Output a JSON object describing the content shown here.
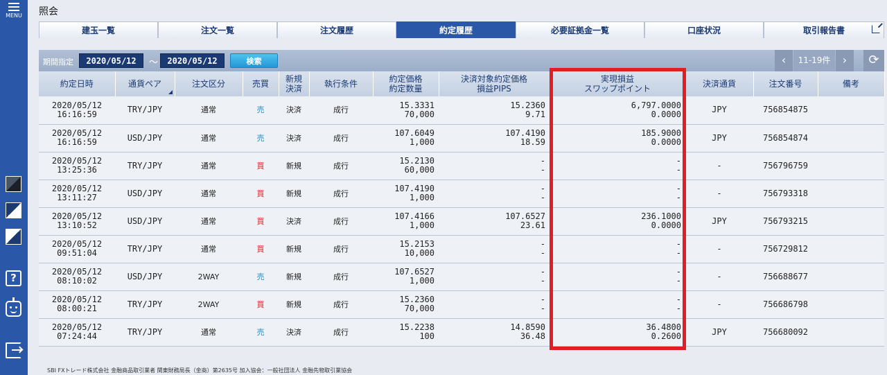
{
  "sidebar": {
    "menu_label": "MENU",
    "help_glyph": "?",
    "icons": [
      "theme-dark-icon",
      "theme-light-icon",
      "theme-blue-icon",
      "help-icon",
      "robot-icon",
      "logout-icon"
    ]
  },
  "page": {
    "title": "照会"
  },
  "tabs": [
    {
      "label": "建玉一覧",
      "active": false
    },
    {
      "label": "注文一覧",
      "active": false
    },
    {
      "label": "注文履歴",
      "active": false
    },
    {
      "label": "約定履歴",
      "active": true
    },
    {
      "label": "必要証拠金一覧",
      "active": false
    },
    {
      "label": "口座状況",
      "active": false
    },
    {
      "label": "取引報告書",
      "active": false
    }
  ],
  "filter": {
    "period_label": "期間指定",
    "date_from": "2020/05/12",
    "tilde": "～",
    "date_to": "2020/05/12",
    "search_label": "検索",
    "prev_glyph": "‹",
    "next_glyph": "›",
    "page_count": "11-19件",
    "refresh_glyph": "⟳"
  },
  "table": {
    "headers": {
      "exec_datetime": "約定日時",
      "currency_pair": "通貨ペア",
      "order_type": "注文区分",
      "side": "売買",
      "new_close_1": "新規",
      "new_close_2": "決済",
      "exec_condition": "執行条件",
      "exec_price_1": "約定価格",
      "exec_price_2": "約定数量",
      "settle_price_1": "決済対象約定価格",
      "settle_price_2": "損益PIPS",
      "pl_1": "実現損益",
      "pl_2": "スワップポイント",
      "settle_currency": "決済通貨",
      "order_no": "注文番号",
      "remarks": "備考"
    },
    "rows": [
      {
        "date": "2020/05/12",
        "time": "16:16:59",
        "pair": "TRY/JPY",
        "type": "通常",
        "side": "売",
        "kind": "決済",
        "cond": "成行",
        "price": "15.3331",
        "qty": "70,000",
        "settle_price": "15.2360",
        "pips": "9.71",
        "pl": "6,797.0000",
        "swap": "0.0000",
        "currency": "JPY",
        "order_no": "756854875"
      },
      {
        "date": "2020/05/12",
        "time": "16:16:59",
        "pair": "USD/JPY",
        "type": "通常",
        "side": "売",
        "kind": "決済",
        "cond": "成行",
        "price": "107.6049",
        "qty": "1,000",
        "settle_price": "107.4190",
        "pips": "18.59",
        "pl": "185.9000",
        "swap": "0.0000",
        "currency": "JPY",
        "order_no": "756854874"
      },
      {
        "date": "2020/05/12",
        "time": "13:25:36",
        "pair": "TRY/JPY",
        "type": "通常",
        "side": "買",
        "kind": "新規",
        "cond": "成行",
        "price": "15.2130",
        "qty": "60,000",
        "settle_price": "-",
        "pips": "-",
        "pl": "-",
        "swap": "-",
        "currency": "-",
        "order_no": "756796759"
      },
      {
        "date": "2020/05/12",
        "time": "13:11:27",
        "pair": "USD/JPY",
        "type": "通常",
        "side": "買",
        "kind": "新規",
        "cond": "成行",
        "price": "107.4190",
        "qty": "1,000",
        "settle_price": "-",
        "pips": "-",
        "pl": "-",
        "swap": "-",
        "currency": "-",
        "order_no": "756793318"
      },
      {
        "date": "2020/05/12",
        "time": "13:10:52",
        "pair": "USD/JPY",
        "type": "通常",
        "side": "買",
        "kind": "決済",
        "cond": "成行",
        "price": "107.4166",
        "qty": "1,000",
        "settle_price": "107.6527",
        "pips": "23.61",
        "pl": "236.1000",
        "swap": "0.0000",
        "currency": "JPY",
        "order_no": "756793215"
      },
      {
        "date": "2020/05/12",
        "time": "09:51:04",
        "pair": "TRY/JPY",
        "type": "通常",
        "side": "買",
        "kind": "新規",
        "cond": "成行",
        "price": "15.2153",
        "qty": "10,000",
        "settle_price": "-",
        "pips": "-",
        "pl": "-",
        "swap": "-",
        "currency": "-",
        "order_no": "756729812"
      },
      {
        "date": "2020/05/12",
        "time": "08:10:02",
        "pair": "USD/JPY",
        "type": "2WAY",
        "side": "売",
        "kind": "新規",
        "cond": "成行",
        "price": "107.6527",
        "qty": "1,000",
        "settle_price": "-",
        "pips": "-",
        "pl": "-",
        "swap": "-",
        "currency": "-",
        "order_no": "756688677"
      },
      {
        "date": "2020/05/12",
        "time": "08:00:21",
        "pair": "TRY/JPY",
        "type": "2WAY",
        "side": "買",
        "kind": "新規",
        "cond": "成行",
        "price": "15.2360",
        "qty": "70,000",
        "settle_price": "-",
        "pips": "-",
        "pl": "-",
        "swap": "-",
        "currency": "-",
        "order_no": "756686798"
      },
      {
        "date": "2020/05/12",
        "time": "07:24:44",
        "pair": "TRY/JPY",
        "type": "通常",
        "side": "売",
        "kind": "決済",
        "cond": "成行",
        "price": "15.2238",
        "qty": "100",
        "settle_price": "14.8590",
        "pips": "36.48",
        "pl": "36.4800",
        "swap": "0.2600",
        "currency": "JPY",
        "order_no": "756680092"
      }
    ]
  },
  "footer": {
    "text": "SBI FXトレード株式会社 金融商品取引業者 関東財務局長（金商）第2635号 加入協会：一般社団法人 金融先物取引業協会"
  },
  "colors": {
    "sell": "#1e8fc7",
    "buy": "#d8231e",
    "accent": "#2a57a8",
    "highlight": "#e01e24"
  }
}
